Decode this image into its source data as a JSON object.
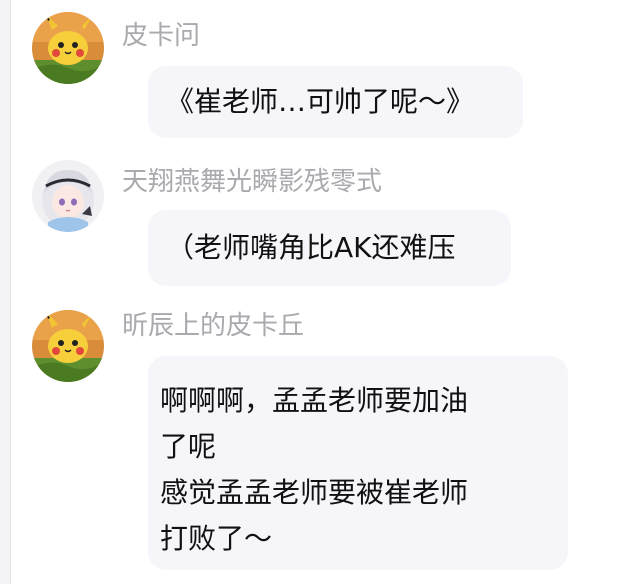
{
  "messages": [
    {
      "sender": "皮卡问",
      "avatar_icon": "pikachu-avatar",
      "lines": [
        "《崔老师…可帅了呢～》"
      ]
    },
    {
      "sender": "天翔燕舞光瞬影残零式",
      "avatar_icon": "anime-girl-avatar",
      "lines": [
        "（老师嘴角比AK还难压"
      ]
    },
    {
      "sender": "昕辰上的皮卡丘",
      "avatar_icon": "pikachu-avatar",
      "lines": [
        "啊啊啊，孟孟老师要加油",
        "了呢",
        "感觉孟孟老师要被崔老师",
        "打败了～"
      ]
    }
  ],
  "colors": {
    "bubble_bg": "#f6f6fa",
    "sender_text": "#a9a9ae",
    "message_text": "#111111"
  }
}
